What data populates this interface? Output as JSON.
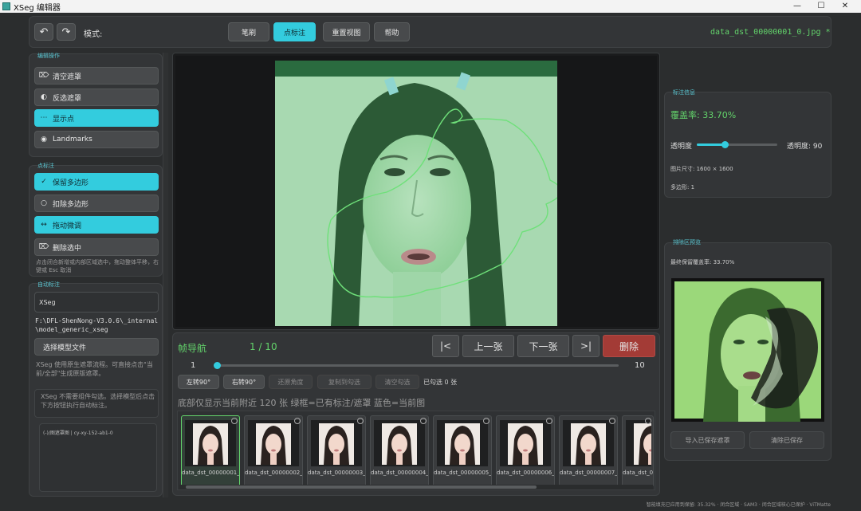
{
  "window": {
    "title": "XSeg 编辑器",
    "controls": [
      "—",
      "☐",
      "✕"
    ]
  },
  "toolbar": {
    "mode_label": "模式:",
    "tools": [
      "笔刷",
      "点标注",
      "重置视图",
      "帮助"
    ],
    "active_tool": "点标注",
    "filename": "data_dst_00000001_0.jpg *"
  },
  "left": {
    "edit_ops": {
      "title": "编辑操作",
      "buttons": [
        {
          "label": "清空遮罩",
          "icon": "⌦",
          "active": false
        },
        {
          "label": "反选遮罩",
          "icon": "◐",
          "active": false
        },
        {
          "label": "显示点",
          "icon": "⋯",
          "active": true
        },
        {
          "label": "Landmarks",
          "icon": "◉",
          "active": false
        }
      ]
    },
    "point_ops": {
      "title": "点标注",
      "buttons": [
        {
          "label": "保留多边形",
          "icon": "✓",
          "active": true
        },
        {
          "label": "扣除多边形",
          "icon": "○",
          "active": false
        },
        {
          "label": "拖动微调",
          "icon": "↔",
          "active": true
        },
        {
          "label": "删除选中",
          "icon": "⌦",
          "active": false
        }
      ],
      "hint": "点击闭合新增或内部区域选中，拖动整体平移，右键或 Esc 取消"
    },
    "auto": {
      "title": "自动标注",
      "model_name": "XSeg",
      "model_path": "F:\\DFL-ShenNong-V3.0.6\\_internal\\model_generic_xseg",
      "choose_button": "选择模型文件",
      "desc": "XSeg 使用原生遮罩流程。可直接点击\"当前/全部\"生成原版遮罩。",
      "note": "XSeg 不需要组件勾选。选择模型后点击下方按钮执行自动标注。",
      "list_item": "(-)/图遮罩图 | cy-xy-152-ab1-0"
    }
  },
  "nav": {
    "title": "帧导航",
    "counter": "1 / 10",
    "buttons": {
      "first": "|<",
      "prev": "上一张",
      "next": "下一张",
      "last": ">|",
      "delete": "删除"
    },
    "slider_min": "1",
    "slider_max": "10",
    "slider_value": 0.0,
    "actions": [
      "左转90°",
      "右转90°",
      "还原角度",
      "复制到勾选",
      "清空勾选"
    ],
    "checked_text": "已勾选 0 张",
    "info": "底部仅显示当前附近 120 张  绿框=已有标注/遮罩  蓝色=当前图",
    "thumbs": [
      "data_dst_00000001_0",
      "data_dst_00000002_0",
      "data_dst_00000003_0",
      "data_dst_00000004_0",
      "data_dst_00000005_0",
      "data_dst_00000006_0",
      "data_dst_00000007_0",
      "data_dst_0"
    ]
  },
  "right": {
    "stats": {
      "title": "标注信息",
      "coverage": "覆盖率: 33.70%",
      "opacity_label": "透明度",
      "opacity_value_text": "透明度: 90",
      "opacity_value": 0.35,
      "image_size": "图片尺寸: 1600 × 1600",
      "polygons": "多边形: 1"
    },
    "preview": {
      "title": "排除区预览",
      "final_coverage": "最终保留覆盖率: 33.70%",
      "import_button": "导入已保存遮罩",
      "clear_button": "清除已保存"
    }
  },
  "status": {
    "text": "智能填充已应用到保留: 35.32% · 闭合区域 · SAM3 · 闭合区域核心已保护 · ViTMatte"
  },
  "colors": {
    "accent": "#33ccde",
    "green": "#63d36b",
    "delete": "#a33b36",
    "panel": "#333537",
    "bg": "#2b2d2e"
  }
}
